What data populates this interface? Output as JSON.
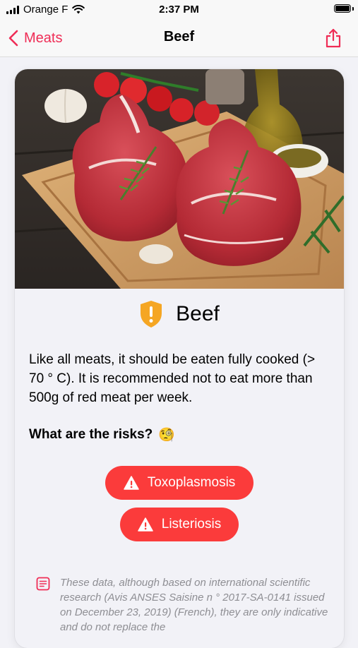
{
  "status_bar": {
    "carrier": "Orange F",
    "time": "2:37 PM"
  },
  "nav": {
    "back_label": "Meats",
    "title": "Beef",
    "back_icon": "chevron-left-icon",
    "share_icon": "share-icon"
  },
  "food": {
    "name": "Beef",
    "warning_icon": "shield-warning-icon",
    "description": "Like all meats, it should be eaten fully cooked (> 70 ° C). It is recommended not to eat more than 500g of red meat per week."
  },
  "risks": {
    "heading": "What are the risks?",
    "emoji": "🧐",
    "items": [
      {
        "label": "Toxoplasmosis",
        "icon": "warning-triangle-icon"
      },
      {
        "label": "Listeriosis",
        "icon": "warning-triangle-icon"
      }
    ]
  },
  "disclaimer": {
    "icon": "document-icon",
    "text": "These data, although based on international scientific research (Avis ANSES Saisine n ° 2017-SA-0141 issued on December 23, 2019) (French), they are only indicative and do not replace the"
  },
  "colors": {
    "accent": "#ef2d56",
    "danger": "#fb3b3b",
    "warning": "#f5a623",
    "background": "#f2f2f7"
  }
}
